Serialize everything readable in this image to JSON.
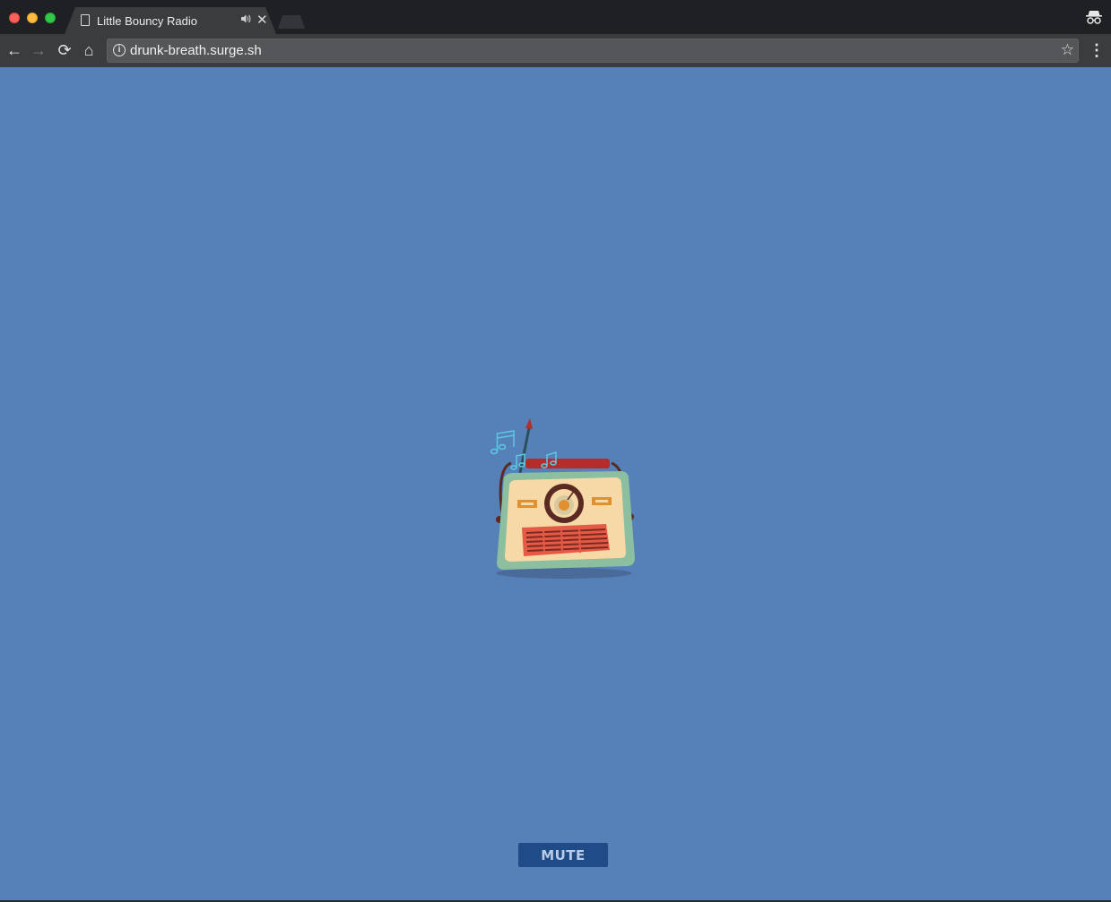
{
  "window": {
    "controls": [
      "close",
      "minimize",
      "maximize"
    ]
  },
  "tab": {
    "title": "Little Bouncy Radio",
    "audio_icon": "speaker-icon",
    "close_glyph": "✕"
  },
  "toolbar": {
    "back_glyph": "←",
    "forward_glyph": "→",
    "reload_glyph": "⟳",
    "home_glyph": "⌂",
    "info_glyph": "i",
    "url": "drunk-breath.surge.sh",
    "star_glyph": "☆",
    "menu_glyph": "⋮"
  },
  "page": {
    "background": "#5580b8",
    "mute_label": "MUTE",
    "mute_color": "#1f4b86"
  }
}
